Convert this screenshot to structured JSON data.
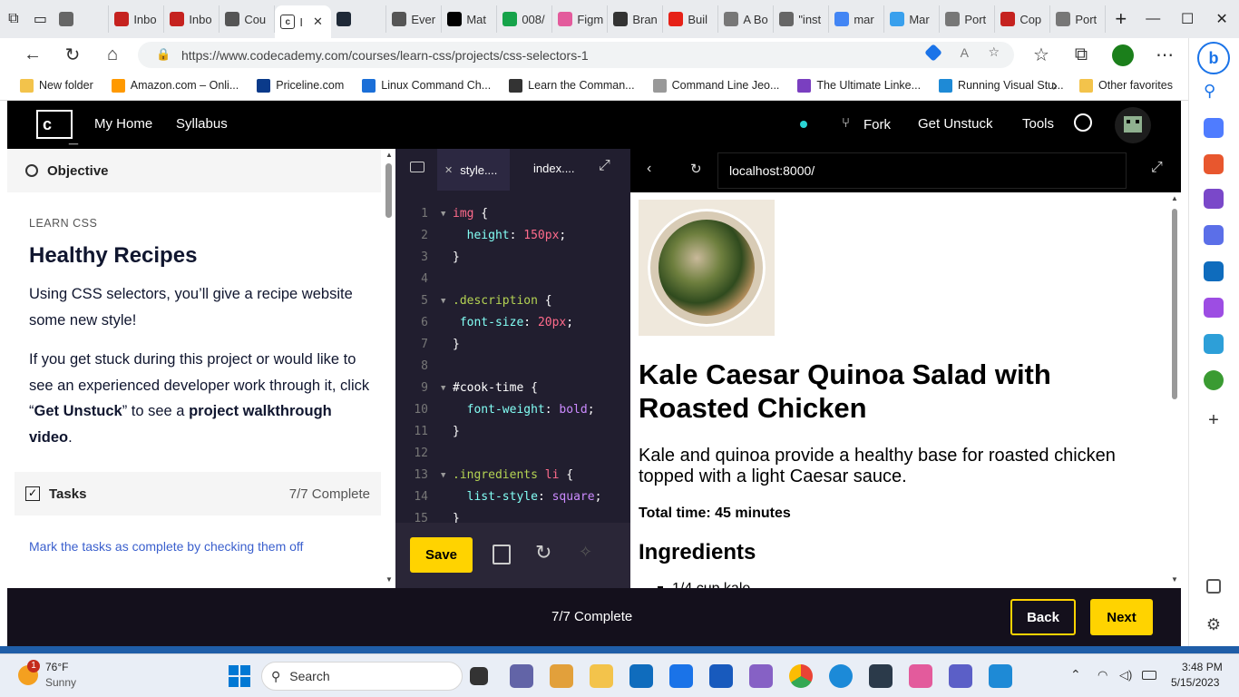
{
  "browser": {
    "tabs": [
      "",
      "Inbo",
      "Inbo",
      "Cou",
      "",
      "Ever",
      "Mat",
      "008/",
      "Figm",
      "Bran",
      "Buil",
      "A Bo",
      "\"inst",
      "mar",
      "Mar",
      "Port",
      "Cop",
      "Port"
    ],
    "active_tab_label": "I",
    "url": "https://www.codecademy.com/courses/learn-css/projects/css-selectors-1",
    "favorites": [
      "New folder",
      "Amazon.com – Onli...",
      "Priceline.com",
      "Linux Command Ch...",
      "Learn the Comman...",
      "Command Line Jeo...",
      "The Ultimate Linke...",
      "Running Visual Stu..."
    ],
    "other_favorites": "Other favorites"
  },
  "codecademy": {
    "nav": [
      "My Home",
      "Syllabus"
    ],
    "fork": "Fork",
    "get_unstuck": "Get Unstuck",
    "tools": "Tools"
  },
  "lesson": {
    "objective_label": "Objective",
    "course": "LEARN CSS",
    "title": "Healthy Recipes",
    "intro": "Using CSS selectors, you’ll give a recipe website some new style!",
    "help_part1": "If you get stuck during this project or would like to see an experienced developer work through it, click “",
    "help_bold1": "Get Unstuck",
    "help_part2": "” to see a ",
    "help_bold2": "project walkthrough video",
    "help_end": ".",
    "tasks_label": "Tasks",
    "tasks_status": "7/7 Complete",
    "tasks_hint": "Mark the tasks as complete by checking them off"
  },
  "editor": {
    "tabs": [
      "style....",
      "index...."
    ],
    "lines": [
      {
        "n": "1",
        "caret": true,
        "html": "<span style='color:#ff6b8b'>img</span> {"
      },
      {
        "n": "2",
        "caret": false,
        "html": "  <span style='color:#83fff5'>height</span>: <span style='color:#ff6b8b'>150px</span>;"
      },
      {
        "n": "3",
        "caret": false,
        "html": "}"
      },
      {
        "n": "4",
        "caret": false,
        "html": ""
      },
      {
        "n": "5",
        "caret": true,
        "html": "<span style='color:#b4d353'>.description</span> {"
      },
      {
        "n": "6",
        "caret": false,
        "html": " <span style='color:#83fff5'>font-size</span>: <span style='color:#ff6b8b'>20px</span>;"
      },
      {
        "n": "7",
        "caret": false,
        "html": "}"
      },
      {
        "n": "8",
        "caret": false,
        "html": ""
      },
      {
        "n": "9",
        "caret": true,
        "html": "<span style='color:#fff'>#cook-time</span> {"
      },
      {
        "n": "10",
        "caret": false,
        "html": "  <span style='color:#83fff5'>font-weight</span>: <span style='color:#cc8bff'>bold</span>;"
      },
      {
        "n": "11",
        "caret": false,
        "html": "}"
      },
      {
        "n": "12",
        "caret": false,
        "html": ""
      },
      {
        "n": "13",
        "caret": true,
        "html": "<span style='color:#b4d353'>.ingredients</span> <span style='color:#ff6b8b'>li</span> {"
      },
      {
        "n": "14",
        "caret": false,
        "html": "  <span style='color:#83fff5'>list-style</span>: <span style='color:#cc8bff'>square</span>;"
      },
      {
        "n": "15",
        "caret": false,
        "html": "}"
      }
    ],
    "save": "Save"
  },
  "preview": {
    "url": "localhost:8000/",
    "heading": "Kale Caesar Quinoa Salad with Roasted Chicken",
    "description": "Kale and quinoa provide a healthy base for roasted chicken topped with a light Caesar sauce.",
    "cook_time": "Total time: 45 minutes",
    "ingredients_heading": "Ingredients",
    "partial_item": "1/4 cup kale"
  },
  "footer": {
    "progress": "7/7 Complete",
    "back": "Back",
    "next": "Next"
  },
  "taskbar": {
    "temp": "76°F",
    "weather": "Sunny",
    "search": "Search",
    "time": "3:48 PM",
    "date": "5/15/2023",
    "notification_count": "1"
  },
  "colors": {
    "accent": "#ffd300",
    "link": "#3a10e5"
  }
}
